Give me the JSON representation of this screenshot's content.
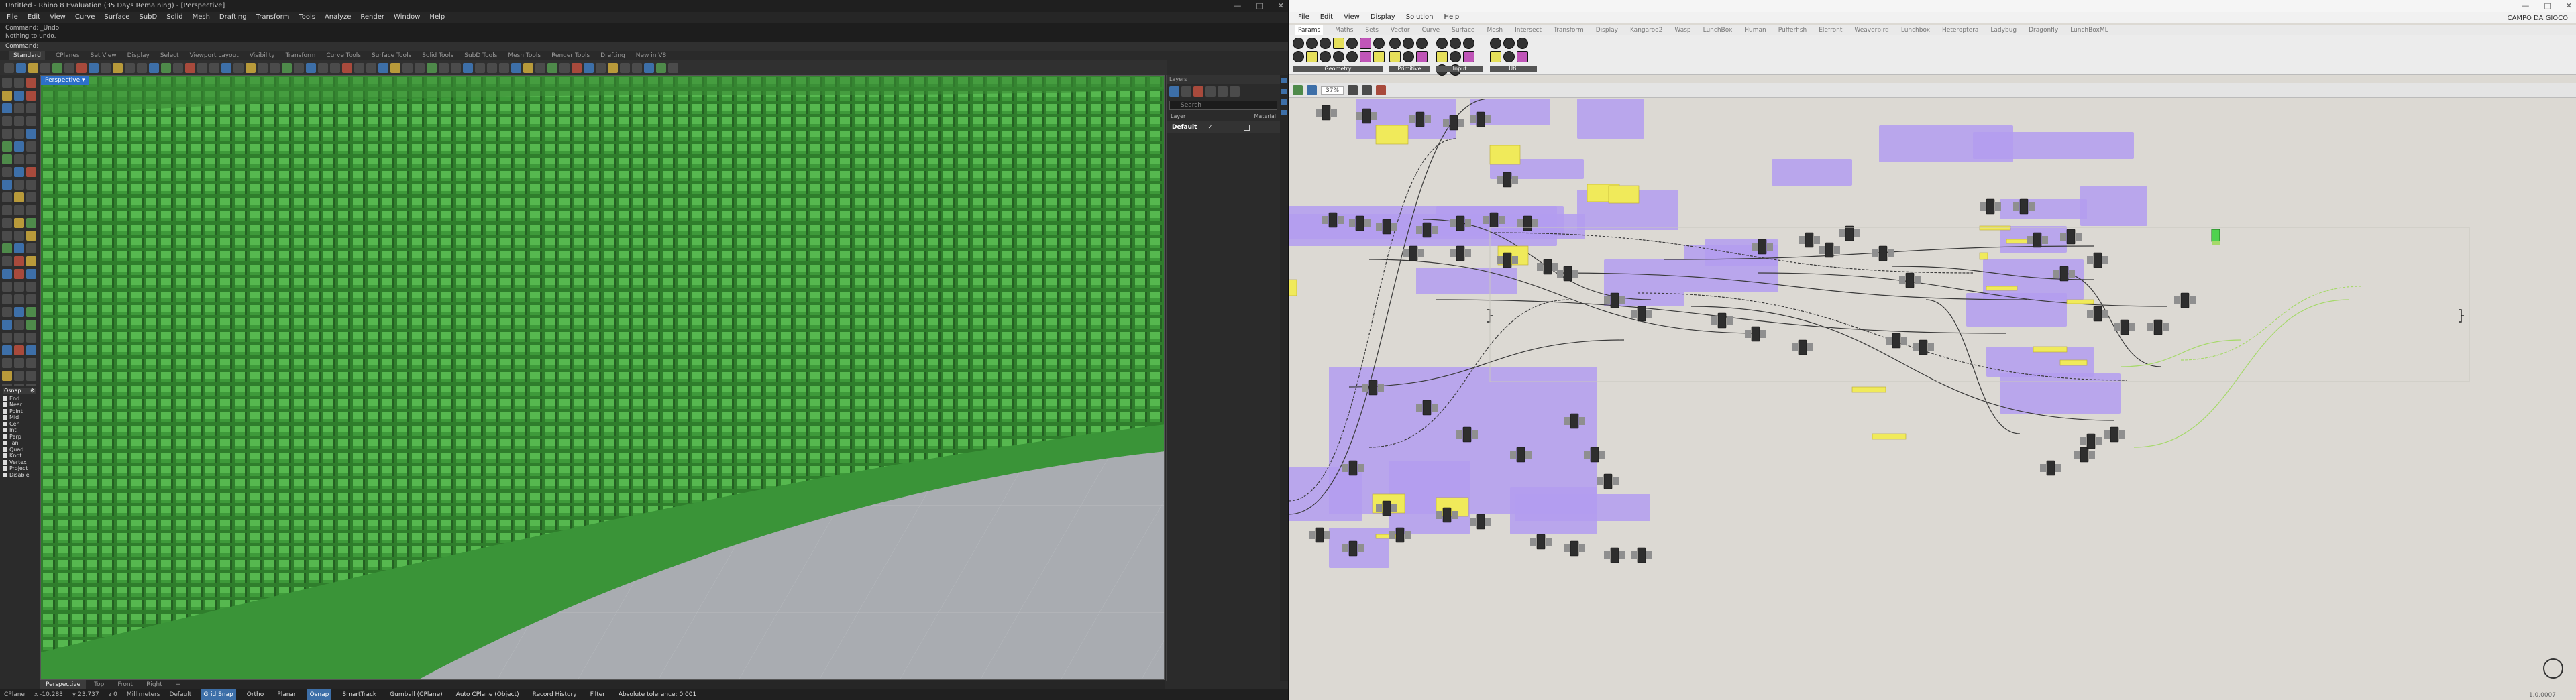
{
  "rhino": {
    "title": "Untitled - Rhino 8 Evaluation (35 Days Remaining) - [Perspective]",
    "menus": [
      "File",
      "Edit",
      "View",
      "Curve",
      "Surface",
      "SubD",
      "Solid",
      "Mesh",
      "Drafting",
      "Transform",
      "Tools",
      "Analyze",
      "Render",
      "Window",
      "Help"
    ],
    "command_history": [
      "Command: _Undo",
      "Nothing to undo."
    ],
    "command_prompt": "Command:",
    "toolbar_tabs": [
      "Standard",
      "CPlanes",
      "Set View",
      "Display",
      "Select",
      "Viewport Layout",
      "Visibility",
      "Transform",
      "Curve Tools",
      "Surface Tools",
      "Solid Tools",
      "SubD Tools",
      "Mesh Tools",
      "Render Tools",
      "Drafting",
      "New in V8"
    ],
    "active_toolbar_tab": "Standard",
    "viewport_label": "Perspective",
    "viewport_tabs": [
      "Perspective",
      "Top",
      "Front",
      "Right"
    ],
    "active_viewport_tab": "Perspective",
    "osnap_header": "Osnap",
    "osnaps": [
      "End",
      "Near",
      "Point",
      "Mid",
      "Cen",
      "Int",
      "Perp",
      "Tan",
      "Quad",
      "Knot",
      "Vertex",
      "Project",
      "Disable"
    ],
    "layers": {
      "header": "Layers",
      "search_placeholder": "Search",
      "col_layer": "Layer",
      "col_material": "Material",
      "rows": [
        {
          "name": "Default",
          "current": "✓"
        }
      ]
    },
    "status": {
      "cplane": "CPlane",
      "x": "x -10.283",
      "y": "y 23.737",
      "z": "z 0",
      "units": "Millimeters",
      "layer": "Default",
      "toggles": [
        {
          "label": "Grid Snap",
          "on": true
        },
        {
          "label": "Ortho",
          "on": false
        },
        {
          "label": "Planar",
          "on": false
        },
        {
          "label": "Osnap",
          "on": true
        },
        {
          "label": "SmartTrack",
          "on": false
        },
        {
          "label": "Gumball (CPlane)",
          "on": false
        },
        {
          "label": "Auto CPlane (Object)",
          "on": false
        },
        {
          "label": "Record History",
          "on": false
        },
        {
          "label": "Filter",
          "on": false
        },
        {
          "label": "Absolute tolerance: 0.001",
          "on": false
        }
      ]
    },
    "colors": {
      "seat_green": "#3e9a3a",
      "ground": "#a9acb1",
      "active_blue": "#2d70c9"
    }
  },
  "grasshopper": {
    "menus": [
      "File",
      "Edit",
      "View",
      "Display",
      "Solution",
      "Help"
    ],
    "document_name": "CAMPO DA GIOCO",
    "tabs": [
      "Params",
      "Maths",
      "Sets",
      "Vector",
      "Curve",
      "Surface",
      "Mesh",
      "Intersect",
      "Transform",
      "Display",
      "Kangaroo2",
      "Wasp",
      "LunchBox",
      "Human",
      "Pufferfish",
      "Elefront",
      "Weaverbird",
      "Lunchbox",
      "Heteroptera",
      "Ladybug",
      "Dragonfly",
      "LunchBoxML"
    ],
    "active_tab": "Params",
    "panel_groups": [
      "Geometry",
      "Primitive",
      "Input",
      "Util"
    ],
    "zoom": "37%",
    "version": "1.0.0007",
    "colors": {
      "canvas": "#dcd9d3",
      "group": "#b39cf0",
      "panel": "#f0ea5a",
      "wire": "#3a3a3a",
      "preview_green": "#a6d96a"
    }
  }
}
